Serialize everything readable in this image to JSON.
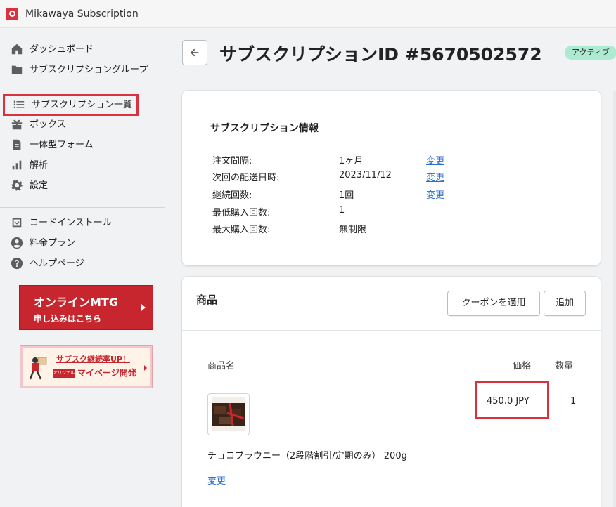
{
  "app": {
    "title": "Mikawaya Subscription"
  },
  "sidebar": {
    "items": [
      {
        "label": "ダッシュボード",
        "icon": "home-icon"
      },
      {
        "label": "サブスクリプショングループ",
        "icon": "folder-icon"
      },
      {
        "label": "サブスクリプション一覧",
        "icon": "list-icon",
        "selected": true
      },
      {
        "label": "ボックス",
        "icon": "gift-icon"
      },
      {
        "label": "一体型フォーム",
        "icon": "document-icon"
      },
      {
        "label": "解析",
        "icon": "analytics-icon"
      },
      {
        "label": "設定",
        "icon": "gear-icon"
      }
    ],
    "secondary": [
      {
        "label": "コードインストール",
        "icon": "install-icon"
      },
      {
        "label": "料金プラン",
        "icon": "account-icon"
      },
      {
        "label": "ヘルプページ",
        "icon": "help-icon"
      }
    ],
    "banner_mtg": {
      "line1": "オンラインMTG",
      "line2": "申し込みはこちら"
    },
    "banner_up": {
      "line1": "サブスク継続率UP！",
      "tag": "オリジナル",
      "line2": "マイページ開発"
    }
  },
  "page": {
    "title": "サブスクリプションID #5670502572",
    "status": "アクティブ"
  },
  "info": {
    "heading": "サブスクリプション情報",
    "rows": [
      {
        "label": "注文間隔:",
        "value": "1ヶ月",
        "action": "変更"
      },
      {
        "label": "次回の配送日時:",
        "value": "2023/11/12",
        "action": "変更"
      },
      {
        "label": "継続回数:",
        "value": "1回",
        "action": "変更"
      },
      {
        "label": "最低購入回数:",
        "value": "1"
      },
      {
        "label": "最大購入回数:",
        "value": "無制限"
      }
    ]
  },
  "products": {
    "heading": "商品",
    "coupon_button": "クーポンを適用",
    "add_button": "追加",
    "columns": {
      "name": "商品名",
      "price": "価格",
      "qty": "数量"
    },
    "items": [
      {
        "name": "チョコブラウニー（2段階割引/定期のみ） 200g",
        "price": "450.0 JPY",
        "qty": "1",
        "action": "変更"
      }
    ]
  },
  "colors": {
    "accent": "#d8323e",
    "link": "#2c6ecb",
    "badge": "#aee9d1"
  }
}
